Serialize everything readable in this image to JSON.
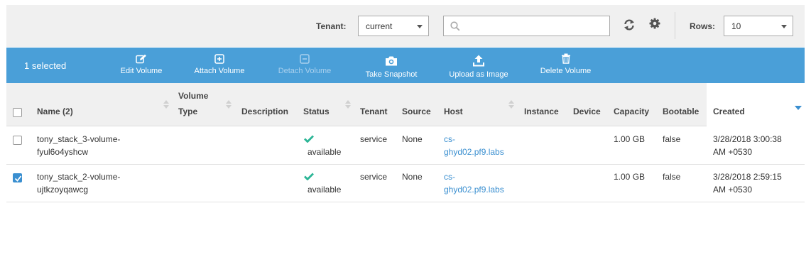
{
  "filter": {
    "tenant_label": "Tenant:",
    "tenant_value": "current",
    "search_placeholder": "",
    "rows_label": "Rows:",
    "rows_value": "10"
  },
  "actions": {
    "selected_count": "1 selected",
    "edit_volume": "Edit Volume",
    "attach_volume": "Attach Volume",
    "detach_volume": "Detach Volume",
    "take_snapshot": "Take Snapshot",
    "upload_as_image": "Upload as Image",
    "delete_volume": "Delete Volume"
  },
  "columns": {
    "name": "Name (2)",
    "volume_type_1": "Volume",
    "volume_type_2": "Type",
    "description": "Description",
    "status": "Status",
    "tenant": "Tenant",
    "source": "Source",
    "host": "Host",
    "instance": "Instance",
    "device": "Device",
    "capacity": "Capacity",
    "bootable": "Bootable",
    "created": "Created"
  },
  "rows": [
    {
      "name_1": "tony_stack_3-volume-",
      "name_2": "fyul6o4yshcw",
      "status": "available",
      "tenant": "service",
      "source": "None",
      "host_1": "cs-",
      "host_2": "ghyd02.pf9.labs",
      "capacity": "1.00 GB",
      "bootable": "false",
      "created_1": "3/28/2018 3:00:38",
      "created_2": "AM +0530",
      "checked": false
    },
    {
      "name_1": "tony_stack_2-volume-",
      "name_2": "ujtkzoyqawcg",
      "status": "available",
      "tenant": "service",
      "source": "None",
      "host_1": "cs-",
      "host_2": "ghyd02.pf9.labs",
      "capacity": "1.00 GB",
      "bootable": "false",
      "created_1": "3/28/2018 2:59:15",
      "created_2": "AM +0530",
      "checked": true
    }
  ],
  "colors": {
    "action_bar": "#4a9fd8",
    "link": "#3a8fd0",
    "status_ok": "#2bb596",
    "header_bg": "#f0f0f0"
  },
  "icons": [
    "search-icon",
    "refresh-icon",
    "gear-icon",
    "edit-icon",
    "plus-square-icon",
    "minus-square-icon",
    "camera-icon",
    "upload-icon",
    "trash-icon",
    "check-icon"
  ]
}
